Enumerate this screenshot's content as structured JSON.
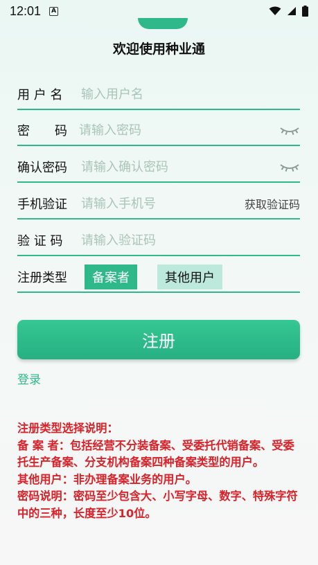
{
  "status_bar": {
    "time": "12:01",
    "notification_icon": "a-icon",
    "wifi_icon": "wifi-icon",
    "signal_icon": "signal-icon",
    "battery_icon": "battery-icon"
  },
  "header": {
    "title": "欢迎使用种业通"
  },
  "form": {
    "username": {
      "label": "用 户 名",
      "placeholder": "输入用户名"
    },
    "password": {
      "label": "密　　码",
      "placeholder": "请输入密码"
    },
    "confirm_password": {
      "label": "确认密码",
      "placeholder": "请输入确认密码"
    },
    "phone": {
      "label": "手机验证",
      "placeholder": "请输入手机号",
      "action_label": "获取验证码"
    },
    "code": {
      "label": "验 证 码",
      "placeholder": "请输入验证码"
    },
    "reg_type": {
      "label": "注册类型",
      "options": [
        "备案者",
        "其他用户"
      ],
      "selected": "备案者"
    }
  },
  "actions": {
    "register_label": "注册",
    "login_label": "登录"
  },
  "notes": {
    "heading": "注册类型选择说明：",
    "line_filer": "备  案  者：包括经营不分装备案、受委托代销备案、受委托生产备案、分支机构备案四种备案类型的用户。",
    "line_other": "其他用户：非办理备案业务的用户。",
    "line_password": "密码说明：密码至少包含大、小写字母、数字、特殊字符中的三种，长度至少10位。"
  },
  "colors": {
    "accent": "#2fb98a",
    "accent_light": "#bde9dc",
    "note_text": "#d8232a"
  }
}
